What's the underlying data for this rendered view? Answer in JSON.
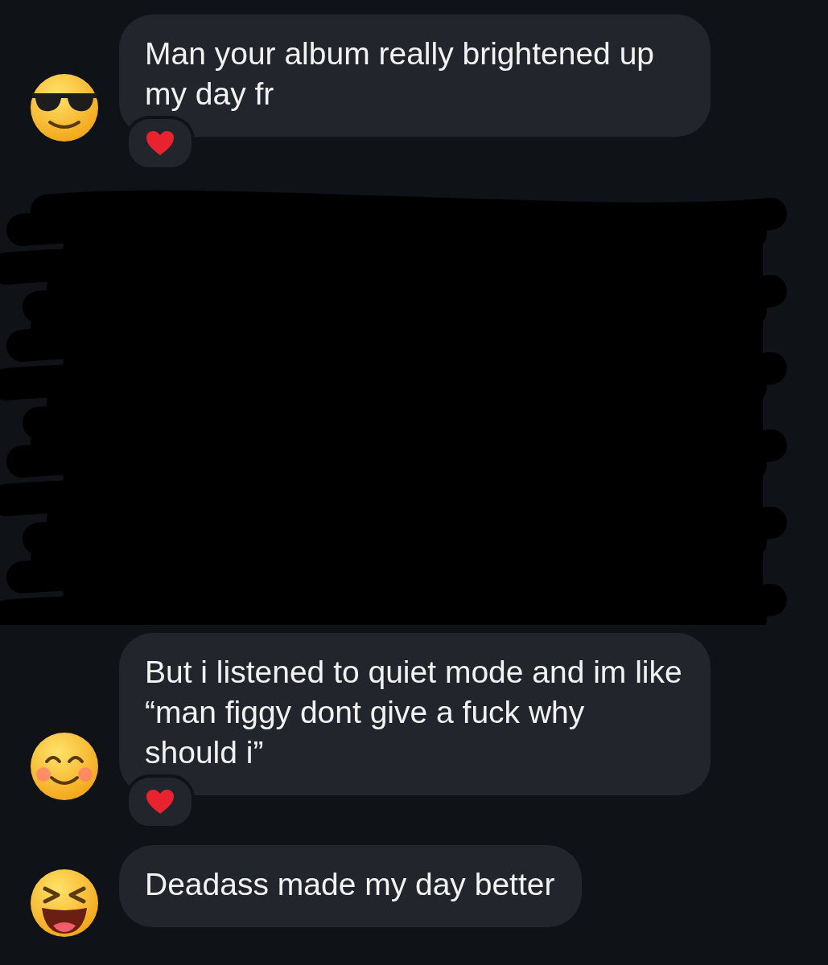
{
  "messages": [
    {
      "kind": "text",
      "avatar": {
        "kind": "sunglasses"
      },
      "text": "Man your album really brightened up my day fr",
      "reacted": true
    },
    {
      "kind": "redacted"
    },
    {
      "kind": "text",
      "avatar": {
        "kind": "blush"
      },
      "text": "But i listened to quiet mode and im like “man figgy dont give a fuck why should i”",
      "reacted": true
    },
    {
      "kind": "text",
      "avatar": {
        "kind": "laugh"
      },
      "text": "Deadass made my day better",
      "reacted": false
    }
  ]
}
